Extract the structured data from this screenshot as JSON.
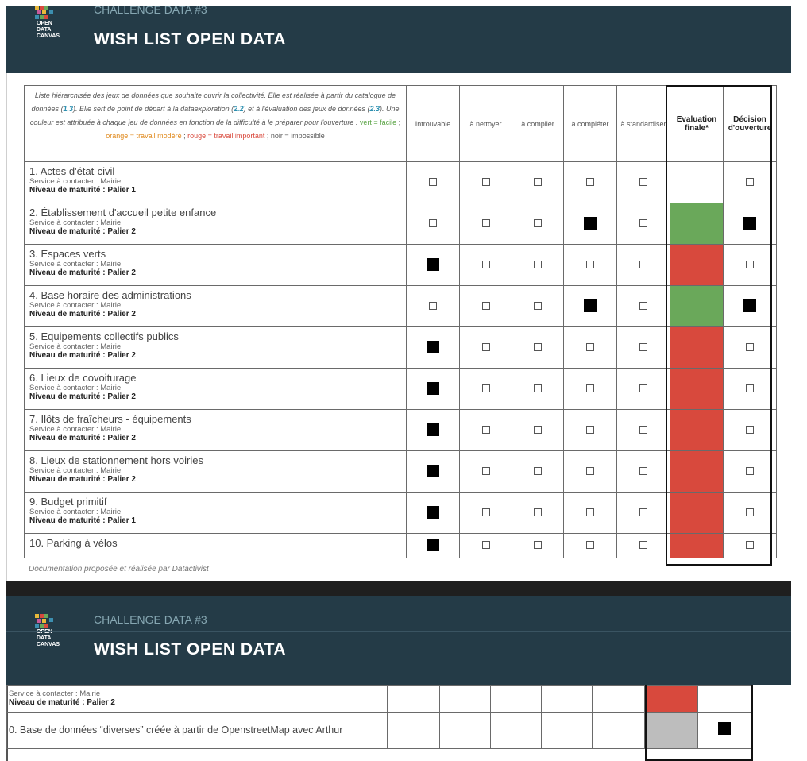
{
  "header": {
    "subtitle": "CHALLENGE DATA #3",
    "title": "WISH LIST OPEN DATA",
    "logo_text": [
      "OPEN",
      "DATA",
      "CANVAS"
    ]
  },
  "intro": {
    "p1": "Liste hiérarchisée des jeux de données que souhaite ouvrir la collectivité. Elle est réalisée à partir du catalogue de données (",
    "ref1": "1.3",
    "p2": "). Elle sert de point de départ à la dataexploration (",
    "ref2": "2.2",
    "p3": ") et à l'évaluation des jeux de données (",
    "ref3": "2.3",
    "p4": "). Une couleur est attribuée à chaque jeu de données en fonction de la difficulté à le préparer pour l'ouverture : ",
    "green": "vert = facile",
    "sep1": " ; ",
    "orange": "orange = travail modéré",
    "sep2": " ; ",
    "red": "rouge = travail important",
    "p5": " ; noir = impossible"
  },
  "columns": [
    {
      "label": "Introuvable"
    },
    {
      "label": "à nettoyer"
    },
    {
      "label": "à compiler"
    },
    {
      "label": "à compléter"
    },
    {
      "label": "à standardiser"
    },
    {
      "label": "Evaluation finale*"
    },
    {
      "label": "Décision d'ouverture"
    }
  ],
  "rows": [
    {
      "name": "1. Actes d'état-civil",
      "service": "Service à contacter : Mairie",
      "level": "Niveau de maturité : Palier 1",
      "checks": [
        false,
        false,
        false,
        false,
        false
      ],
      "eval": "none",
      "decision": false
    },
    {
      "name": "2. Établissement d'accueil petite enfance",
      "service": "Service à contacter :  Mairie",
      "level": "Niveau de maturité : Palier 2",
      "checks": [
        false,
        false,
        false,
        true,
        false
      ],
      "eval": "green",
      "decision": true
    },
    {
      "name": "3. Espaces verts",
      "service": "Service à contacter : Mairie",
      "level": "Niveau de maturité : Palier 2",
      "checks": [
        true,
        false,
        false,
        false,
        false
      ],
      "eval": "red",
      "decision": false
    },
    {
      "name": "4. Base horaire des administrations",
      "service": "Service à contacter : Mairie",
      "level": "Niveau de maturité : Palier 2",
      "checks": [
        false,
        false,
        false,
        true,
        false
      ],
      "eval": "green",
      "decision": true
    },
    {
      "name": "5. Equipements collectifs publics",
      "service": "Service à contacter : Mairie",
      "level": "Niveau de maturité : Palier 2",
      "checks": [
        true,
        false,
        false,
        false,
        false
      ],
      "eval": "red",
      "decision": false
    },
    {
      "name": "6. Lieux de covoiturage",
      "service": "Service à contacter : Mairie",
      "level": "Niveau de maturité : Palier 2",
      "checks": [
        true,
        false,
        false,
        false,
        false
      ],
      "eval": "red",
      "decision": false
    },
    {
      "name": "7. Ilôts de fraîcheurs - équipements",
      "service": "Service à contacter : Mairie",
      "level": "Niveau de maturité : Palier 2",
      "checks": [
        true,
        false,
        false,
        false,
        false
      ],
      "eval": "red",
      "decision": false
    },
    {
      "name": "8. Lieux de stationnement hors voiries",
      "service": "Service à contacter : Mairie",
      "level": "Niveau de maturité : Palier 2",
      "checks": [
        true,
        false,
        false,
        false,
        false
      ],
      "eval": "red",
      "decision": false
    },
    {
      "name": "9. Budget primitif",
      "service": "Service à contacter : Mairie",
      "level": "Niveau de maturité : Palier 1",
      "checks": [
        true,
        false,
        false,
        false,
        false
      ],
      "eval": "red",
      "decision": false
    },
    {
      "name": "10. Parking à vélos",
      "service": "",
      "level": "",
      "checks": [
        true,
        false,
        false,
        false,
        false
      ],
      "eval": "red",
      "decision": false
    }
  ],
  "footnote": "Documentation proposée et réalisée par Datactivist",
  "page2": {
    "rows": [
      {
        "service": "Service à contacter : Mairie",
        "level": "Niveau de maturité : Palier 2",
        "eval": "red",
        "decision": "empty"
      },
      {
        "name": "0.  Base de données “diverses” créée à partir de OpenstreetMap avec Arthur",
        "eval": "grey",
        "decision": "checked"
      }
    ]
  },
  "colors": {
    "header_bg": "#243b47",
    "eval_green": "#6aa85a",
    "eval_red": "#d8493d",
    "eval_grey": "#bdbdbd"
  }
}
